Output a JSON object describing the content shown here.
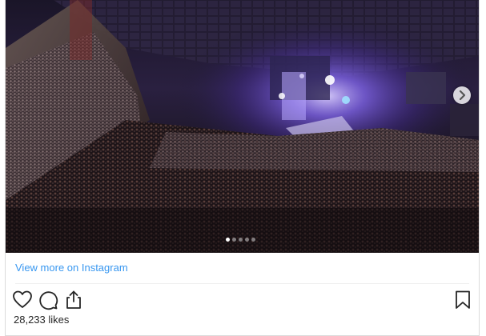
{
  "media": {
    "image_description_icon": "concert-arena-photo",
    "carousel_total": 5,
    "carousel_active_index": 0
  },
  "links": {
    "view_more": "View more on Instagram"
  },
  "actions": {
    "like_icon": "heart-icon",
    "comment_icon": "comment-icon",
    "share_icon": "share-icon",
    "save_icon": "bookmark-icon"
  },
  "stats": {
    "likes": "28,233 likes"
  },
  "colors": {
    "link": "#3897f0",
    "text": "#262626",
    "border": "#dbdbdb",
    "stage_light": "#8a6cff"
  }
}
